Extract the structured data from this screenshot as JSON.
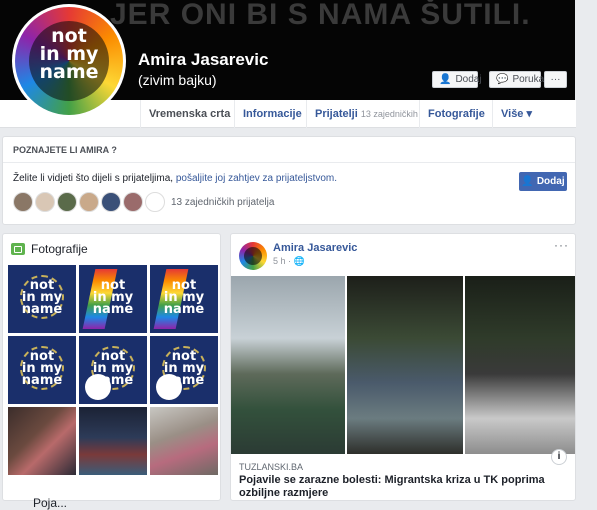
{
  "cover": {
    "text": "JER ONI BI S NAMA ŠUTILI."
  },
  "profile": {
    "avatar_text": "not\nin my\nname",
    "name": "Amira Jasarevic",
    "subtitle": "(zivim bajku)",
    "add_label": "Dodaj",
    "message_label": "Poruka",
    "more_label": "···"
  },
  "tabs": [
    {
      "label": "Vremenska crta"
    },
    {
      "label": "Informacije"
    },
    {
      "label": "Prijatelji",
      "count": "13 zajedničkih"
    },
    {
      "label": "Fotografije"
    },
    {
      "label": "Više ▾"
    }
  ],
  "know": {
    "title": "POZNAJETE LI AMIRA ?",
    "text_before": "Želite li vidjeti što dijeli s prijateljima, ",
    "text_link": "pošaljite joj zahtjev za prijateljstvom.",
    "button_label": "Dodaj",
    "mutual_text": "13 zajedničkih prijatelja"
  },
  "photos": {
    "heading": "Fotografije",
    "badge_text": "not\nin my\nname",
    "next_section": "Poja..."
  },
  "post": {
    "author": "Amira Jasarevic",
    "time": "5 h ·",
    "more": "···",
    "info": "i",
    "source": "TUZLANSKI.BA",
    "headline": "Pojavile se zarazne bolesti: Migrantska kriza u TK poprima ozbiljne razmjere"
  },
  "colors": {
    "link": "#365899",
    "primary_button": "#4267b2",
    "page_bg": "#e9ebee"
  }
}
